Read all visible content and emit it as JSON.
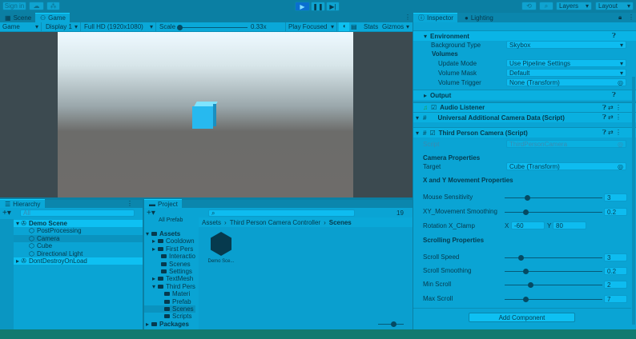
{
  "toolbar": {
    "sign_in": "Sign in",
    "play_active": true,
    "layers": "Layers",
    "layout": "Layout"
  },
  "game_tabs": [
    {
      "label": "Scene",
      "icon": "scene-icon"
    },
    {
      "label": "Game",
      "icon": "gamepad-icon",
      "active": true
    }
  ],
  "game_toolbar": {
    "view": "Game",
    "display": "Display 1",
    "resolution": "Full HD (1920x1080)",
    "scale_label": "Scale",
    "scale_value": "0.33x",
    "play_mode": "Play Focused",
    "stats": "Stats",
    "gizmos": "Gizmos"
  },
  "inspector": {
    "tabs": [
      {
        "label": "Inspector",
        "active": true
      },
      {
        "label": "Lighting"
      }
    ],
    "environment": {
      "title": "Environment",
      "background_type_label": "Background Type",
      "background_type": "Skybox",
      "volumes": "Volumes",
      "update_mode_label": "Update Mode",
      "update_mode": "Use Pipeline Settings",
      "volume_mask_label": "Volume Mask",
      "volume_mask": "Default",
      "volume_trigger_label": "Volume Trigger",
      "volume_trigger": "None (Transform)"
    },
    "output": "Output",
    "components": {
      "audio_listener": "Audio Listener",
      "uacd": "Universal Additional Camera Data (Script)",
      "tpc": "Third Person Camera (Script)"
    },
    "script_label": "Script",
    "script_value": "ThirdPersonCamera",
    "camera_properties": "Camera Properties",
    "target_label": "Target",
    "target_value": "Cube (Transform)",
    "xy_section": "X and Y Movement Properties",
    "sliders": [
      {
        "label": "Mouse Sensitivity",
        "value": "3",
        "fill": 0.23
      },
      {
        "label": "XY_Movement Smoothing",
        "value": "0.2",
        "fill": 0.21
      },
      {
        "label": "Scroll Speed",
        "value": "3",
        "fill": 0.16
      },
      {
        "label": "Scroll Smoothing",
        "value": "0.2",
        "fill": 0.21
      },
      {
        "label": "Min Scroll",
        "value": "2",
        "fill": 0.26
      },
      {
        "label": "Max Scroll",
        "value": "7",
        "fill": 0.21
      }
    ],
    "rotation_label": "Rotation X_Clamp",
    "rot_x_label": "X",
    "rot_x": "-60",
    "rot_y_label": "Y",
    "rot_y": "80",
    "scrolling_section": "Scrolling Properties",
    "add_component": "Add Component"
  },
  "hierarchy": {
    "title": "Hierarchy",
    "search_placeholder": "All",
    "items": [
      "Demo Scene",
      "PostProcessing",
      "Camera",
      "Cube",
      "Directional Light",
      "DontDestroyOnLoad"
    ]
  },
  "project": {
    "title": "Project",
    "badge": "19",
    "all_prefabs": "All Prefab",
    "tree": [
      "Assets",
      "Cooldown",
      "First Pers",
      "Interactio",
      "Scenes",
      "Settings",
      "TextMesh",
      "Third Pers",
      "Materi",
      "Prefab",
      "Scenes",
      "Scripts",
      "Packages"
    ],
    "breadcrumb": [
      "Assets",
      "Third Person Camera Controller",
      "Scenes"
    ],
    "asset": "Demo Sce..."
  }
}
